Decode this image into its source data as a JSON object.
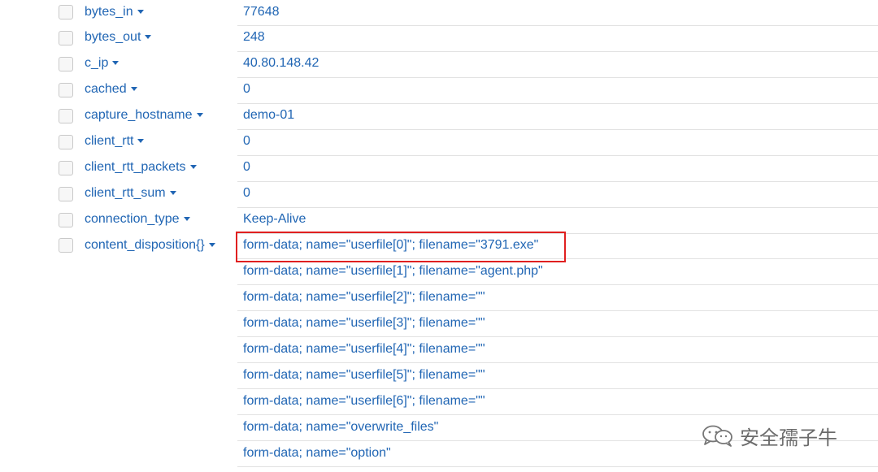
{
  "fields": [
    {
      "name": "bytes_in",
      "value": "77648"
    },
    {
      "name": "bytes_out",
      "value": "248"
    },
    {
      "name": "c_ip",
      "value": "40.80.148.42"
    },
    {
      "name": "cached",
      "value": "0"
    },
    {
      "name": "capture_hostname",
      "value": "demo-01"
    },
    {
      "name": "client_rtt",
      "value": "0"
    },
    {
      "name": "client_rtt_packets",
      "value": "0"
    },
    {
      "name": "client_rtt_sum",
      "value": "0"
    },
    {
      "name": "connection_type",
      "value": "Keep-Alive"
    },
    {
      "name": "content_disposition{}",
      "values": [
        "form-data; name=\"userfile[0]\"; filename=\"3791.exe\"",
        "form-data; name=\"userfile[1]\"; filename=\"agent.php\"",
        "form-data; name=\"userfile[2]\"; filename=\"\"",
        "form-data; name=\"userfile[3]\"; filename=\"\"",
        "form-data; name=\"userfile[4]\"; filename=\"\"",
        "form-data; name=\"userfile[5]\"; filename=\"\"",
        "form-data; name=\"userfile[6]\"; filename=\"\"",
        "form-data; name=\"overwrite_files\"",
        "form-data; name=\"option\""
      ]
    }
  ],
  "watermark": {
    "text": "安全孺子牛",
    "icon": "wechat-icon"
  },
  "colors": {
    "link": "#2166b4",
    "highlight": "#e02020",
    "separator": "#e2e2e2"
  }
}
